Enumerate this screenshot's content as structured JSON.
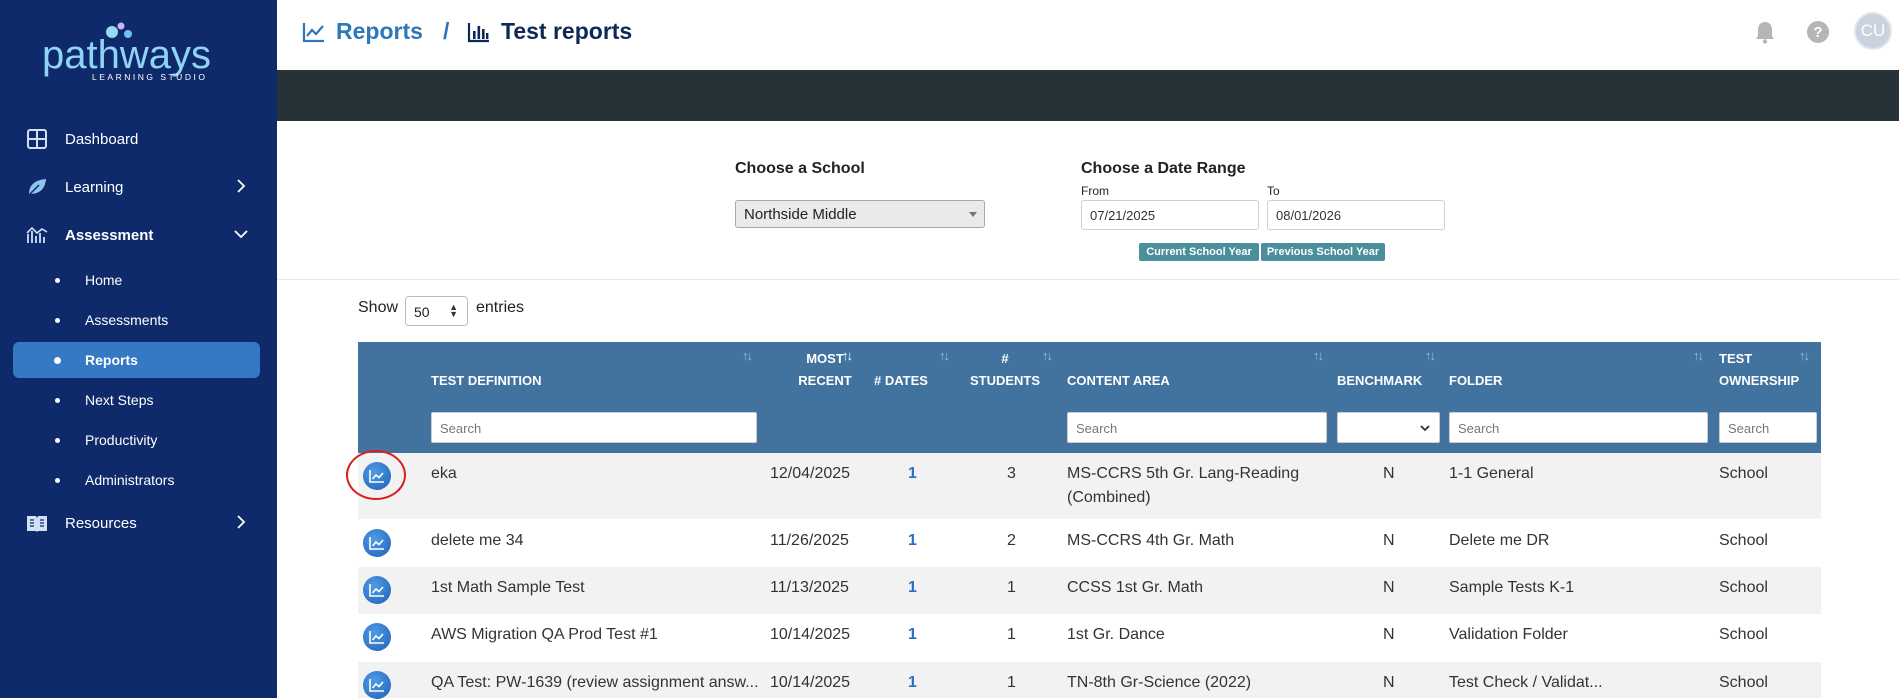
{
  "sidebar": {
    "brand": "pathways",
    "brand_sub": "LEARNING STUDIO",
    "items": [
      {
        "label": "Dashboard"
      },
      {
        "label": "Learning"
      },
      {
        "label": "Assessment"
      },
      {
        "label": "Resources"
      }
    ],
    "assessment_children": [
      {
        "label": "Home"
      },
      {
        "label": "Assessments"
      },
      {
        "label": "Reports"
      },
      {
        "label": "Next Steps"
      },
      {
        "label": "Productivity"
      },
      {
        "label": "Administrators"
      }
    ]
  },
  "header": {
    "crumb_parent": "Reports",
    "crumb_separator": "/",
    "crumb_current": "Test reports",
    "avatar_initials": "CU",
    "help_glyph": "?"
  },
  "filters": {
    "school_title": "Choose a School",
    "school_value": "Northside Middle",
    "date_title": "Choose a Date Range",
    "from_label": "From",
    "to_label": "To",
    "from_value": "07/21/2025",
    "to_value": "08/01/2026",
    "current_year_button": "Current School Year",
    "previous_year_button": "Previous School Year"
  },
  "entries": {
    "show_label": "Show",
    "entries_label": "entries",
    "page_size": "50"
  },
  "table": {
    "headers": {
      "test_definition": "TEST DEFINITION",
      "most_recent_1": "MOST",
      "most_recent_2": "RECENT",
      "dates": "# DATES",
      "students_1": "#",
      "students_2": "STUDENTS",
      "content_area": "CONTENT AREA",
      "benchmark": "BENCHMARK",
      "folder": "FOLDER",
      "ownership_1": "TEST",
      "ownership_2": "OWNERSHIP"
    },
    "search_placeholder": "Search",
    "rows": [
      {
        "test": "eka",
        "recent": "12/04/2025",
        "dates": "1",
        "students": "3",
        "content": "MS-CCRS 5th Gr. Lang-Reading",
        "content2": "(Combined)",
        "benchmark": "N",
        "folder": "1-1 General",
        "ownership": "School"
      },
      {
        "test": "delete me 34",
        "recent": "11/26/2025",
        "dates": "1",
        "students": "2",
        "content": "MS-CCRS 4th Gr. Math",
        "content2": "",
        "benchmark": "N",
        "folder": "Delete me DR",
        "ownership": "School"
      },
      {
        "test": "1st Math Sample Test",
        "recent": "11/13/2025",
        "dates": "1",
        "students": "1",
        "content": "CCSS 1st Gr. Math",
        "content2": "",
        "benchmark": "N",
        "folder": "Sample Tests K-1",
        "ownership": "School"
      },
      {
        "test": "AWS Migration QA Prod Test #1",
        "recent": "10/14/2025",
        "dates": "1",
        "students": "1",
        "content": "1st Gr. Dance",
        "content2": "",
        "benchmark": "N",
        "folder": "Validation Folder",
        "ownership": "School"
      },
      {
        "test": "QA Test: PW-1639 (review assignment answ...",
        "recent": "10/14/2025",
        "dates": "1",
        "students": "1",
        "content": "TN-8th Gr-Science (2022)",
        "content2": "",
        "benchmark": "N",
        "folder": "Test Check / Validat...",
        "ownership": "School"
      }
    ]
  },
  "colors": {
    "sidebar_bg": "#0f2a6b",
    "active_item": "#3578c4",
    "table_header": "#42739e",
    "dark_bar": "#263238",
    "link_blue": "#2a6fc7",
    "highlight": "#d81e1e"
  }
}
